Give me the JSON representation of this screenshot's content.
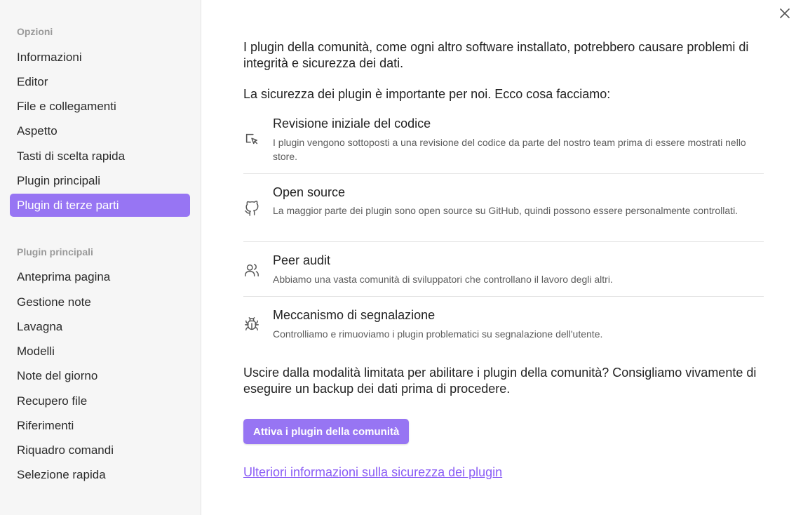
{
  "sidebar": {
    "section_options": "Opzioni",
    "options_items": [
      {
        "label": "Informazioni"
      },
      {
        "label": "Editor"
      },
      {
        "label": "File e collegamenti"
      },
      {
        "label": "Aspetto"
      },
      {
        "label": "Tasti di scelta rapida"
      },
      {
        "label": "Plugin principali"
      },
      {
        "label": "Plugin di terze parti",
        "active": true
      }
    ],
    "section_core_plugins": "Plugin principali",
    "core_plugin_items": [
      {
        "label": "Anteprima pagina"
      },
      {
        "label": "Gestione note"
      },
      {
        "label": "Lavagna"
      },
      {
        "label": "Modelli"
      },
      {
        "label": "Note del giorno"
      },
      {
        "label": "Recupero file"
      },
      {
        "label": "Riferimenti"
      },
      {
        "label": "Riquadro comandi"
      },
      {
        "label": "Selezione rapida"
      }
    ],
    "active_color": "#9775f3"
  },
  "main": {
    "intro": "I plugin della comunità, come ogni altro software installato, potrebbero causare problemi di integrità e sicurezza dei dati.",
    "security_heading": "La sicurezza dei plugin è importante per noi. Ecco cosa facciamo:",
    "features": [
      {
        "icon": "code-review-icon",
        "title": "Revisione iniziale del codice",
        "description": "I plugin vengono sottoposti a una revisione del codice da parte del nostro team prima di essere mostrati nello store."
      },
      {
        "icon": "github-icon",
        "title": "Open source",
        "description": "La maggior parte dei plugin sono open source su GitHub, quindi possono essere personalmente controllati."
      },
      {
        "icon": "users-icon",
        "title": "Peer audit",
        "description": "Abbiamo una vasta comunità di sviluppatori che controllano il lavoro degli altri."
      },
      {
        "icon": "bug-icon",
        "title": "Meccanismo di segnalazione",
        "description": "Controlliamo e rimuoviamo i plugin problematici su segnalazione dell'utente."
      }
    ],
    "exit_prompt": "Uscire dalla modalità limitata per abilitare i plugin della comunità? Consigliamo vivamente di eseguire un backup dei dati prima di procedere.",
    "enable_button_label": "Attiva i plugin della comunità",
    "learn_more_link": "Ulteriori informazioni sulla sicurezza dei plugin",
    "accent_color": "#9775f3",
    "link_color": "#8a5cf5"
  }
}
